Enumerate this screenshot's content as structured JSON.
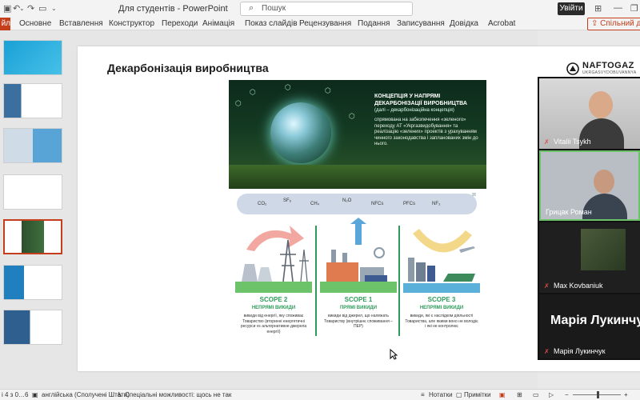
{
  "titlebar": {
    "doc_title": "Для студентів  -  PowerPoint",
    "search_placeholder": "Пошук",
    "signin_label": "Увійти"
  },
  "ribbon": {
    "file_tab": "йл",
    "tabs": [
      "Основне",
      "Вставлення",
      "Конструктор",
      "Переходи",
      "Анімація",
      "Показ слайдів",
      "Рецензування",
      "Подання",
      "Записування",
      "Довідка",
      "Acrobat"
    ],
    "share_label": "Спільний дос"
  },
  "thumbnails": {
    "selected_index": 5
  },
  "slide": {
    "title": "Декарбонізація виробництва",
    "logo_word": "NAFTOGAZ",
    "logo_sub": "UKRGASVYDOBUVANNYA",
    "concept_title": "КОНЦЕПЦІЯ У НАПРЯМІ ДЕКАРБОНІЗАЦІЇ ВИРОБНИЦТВА",
    "concept_sub": "(далі – декарбонізаційна концепція)",
    "concept_body": "спрямована на забезпечення «зеленого» переходу АТ «Укргазвидобування» та реалізацію «зелених» проектів з урахуванням чинного законодавства і запланованих змін до нього.",
    "gases": [
      "CO₂",
      "SF₆",
      "CH₄",
      "N₂O",
      "NFCs",
      "PFCs",
      "NF₃"
    ],
    "scopes": [
      {
        "title": "SCOPE 2",
        "type": "НЕПРЯМІ ВИКИДИ",
        "desc": "викиди від енергії, яку споживає Товариство (вторинні енергетичні ресурси vs альтернативне джерела енергії)"
      },
      {
        "title": "SCOPE 1",
        "type": "ПРЯМІ ВИКИДИ",
        "desc": "викиди від джерел, що належать Товариству (внутрішнє споживання – ПЕР)"
      },
      {
        "title": "SCOPE 3",
        "type": "НЕПРЯМІ ВИКИДИ",
        "desc": "викиди, які є наслідком діяльності Товариства, але якими воно не володіє і які не контролює"
      }
    ]
  },
  "participants": [
    {
      "name": "Vitalii Tsykh"
    },
    {
      "name": "Грицак Роман"
    },
    {
      "name": "Max Kovbaniuk"
    },
    {
      "name": "Марія Лукинчук",
      "big_name": "Марія Лукинчу"
    }
  ],
  "status": {
    "slide_counter": "і 4 з 0…6",
    "language": "англійська (Сполучені Штати)",
    "accessibility": "Спеціальні можливості: щось не так",
    "notes": "Нотатки",
    "comments": "Примітки"
  },
  "colors": {
    "accent": "#c43e1c",
    "scope_green": "#2e9b5a"
  }
}
